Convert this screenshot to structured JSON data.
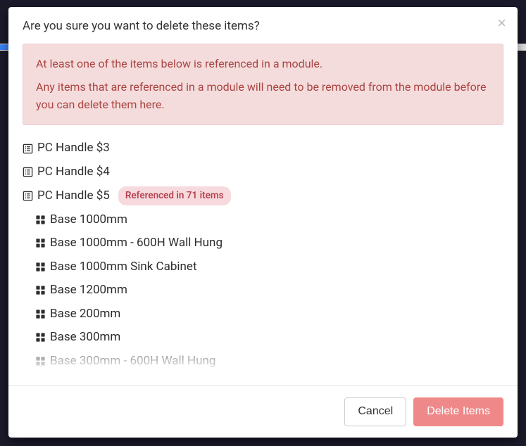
{
  "modal": {
    "title": "Are you sure you want to delete these items?",
    "alert": {
      "line1": "At least one of the items below is referenced in a module.",
      "line2": "Any items that are referenced in a module will need to be removed from the module before you can delete them here."
    },
    "items": [
      {
        "label": "PC Handle $3"
      },
      {
        "label": "PC Handle $4"
      },
      {
        "label": "PC Handle $5",
        "badge": "Referenced in 71 items",
        "children": [
          "Base 1000mm",
          "Base 1000mm - 600H Wall Hung",
          "Base 1000mm Sink Cabinet",
          "Base 1200mm",
          "Base 200mm",
          "Base 300mm",
          "Base 300mm - 600H Wall Hung"
        ]
      }
    ],
    "footer": {
      "cancel": "Cancel",
      "delete": "Delete Items"
    }
  }
}
